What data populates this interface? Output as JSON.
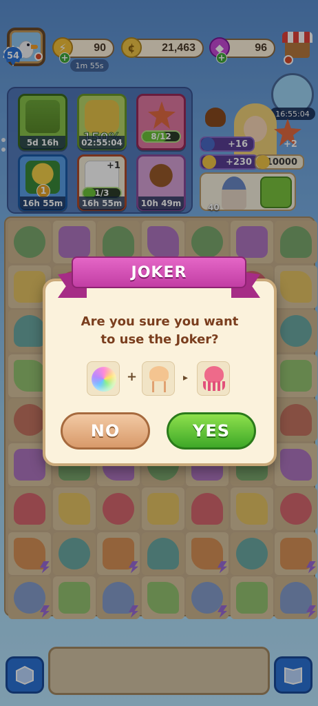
{
  "top_bar": {
    "level": "54",
    "energy": "90",
    "energy_timer": "1m 55s",
    "coins": "21,463",
    "gems": "96",
    "plus": "+"
  },
  "event_panel": {
    "tiles": [
      {
        "label": "5d 16h"
      },
      {
        "label": "02:55:04",
        "overlay": "150%"
      },
      {
        "label": "",
        "progress": "8/12",
        "progress_fraction": 0.667
      },
      {
        "label": "16h 55m",
        "badge": "1"
      },
      {
        "label": "16h 55m",
        "progress": "1/3",
        "progress_fraction": 0.333,
        "plus": "+1"
      },
      {
        "label": "10h 49m"
      }
    ]
  },
  "orders": {
    "timer": "16:55:04",
    "star_bonus": "+2",
    "rewards": [
      "+16",
      "+230",
      "+10000"
    ],
    "order_count": "40"
  },
  "dialog": {
    "title": "JOKER",
    "question_line1": "Are you sure you want",
    "question_line2": "to use the Joker?",
    "plus_symbol": "+",
    "arrow_symbol": "▸",
    "no_label": "NO",
    "yes_label": "YES"
  },
  "colors": {
    "ribbon": "#c23ea4",
    "yes": "#3ea828",
    "no": "#d89a6a",
    "dialog_bg": "#fbf2dc",
    "question_text": "#7a3e1e"
  }
}
